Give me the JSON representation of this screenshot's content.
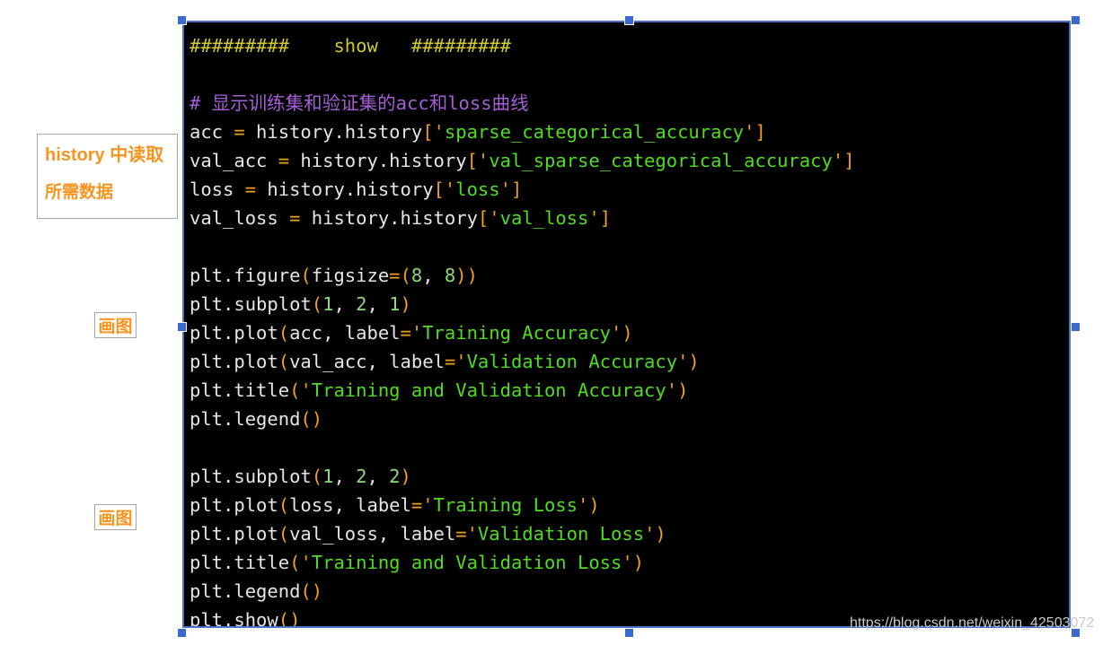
{
  "annotations": {
    "history_box": {
      "line1": "history 中读取",
      "line2": "所需数据"
    },
    "draw_box_1": "画图",
    "draw_box_2": "画图"
  },
  "watermark": "https://blog.csdn.net/weixin_42503072",
  "colors": {
    "background": "#ffffff",
    "code_background": "#000000",
    "selection_border": "#4a72c4",
    "handle": "#3a69cf",
    "annotation_text": "#f7941e",
    "annotation_border": "#a6a6a6",
    "header_comment": "#cfcb2e",
    "comment": "#a45ed6",
    "identifier": "#e6e6e6",
    "punctuation": "#f0a020",
    "string": "#4fdd1e",
    "number": "#8fd97a",
    "watermark": "#c9c9c9"
  },
  "code": {
    "language": "python",
    "lines": [
      {
        "id": "l1",
        "text": "#########    show   #########",
        "tokens": [
          {
            "t": "#########    show   #########",
            "c": "head"
          }
        ]
      },
      {
        "id": "l2",
        "text": "",
        "tokens": []
      },
      {
        "id": "l3",
        "text": "# 显示训练集和验证集的acc和loss曲线",
        "tokens": [
          {
            "t": "# 显示训练集和验证集的acc和loss曲线",
            "c": "comment"
          }
        ]
      },
      {
        "id": "l4",
        "text": "acc = history.history['sparse_categorical_accuracy']",
        "tokens": [
          {
            "t": "acc ",
            "c": "name"
          },
          {
            "t": "=",
            "c": "punc"
          },
          {
            "t": " history.history",
            "c": "name"
          },
          {
            "t": "[",
            "c": "punc"
          },
          {
            "t": "'",
            "c": "punc"
          },
          {
            "t": "sparse_categorical_accuracy",
            "c": "str"
          },
          {
            "t": "'",
            "c": "punc"
          },
          {
            "t": "]",
            "c": "punc"
          }
        ]
      },
      {
        "id": "l5",
        "text": "val_acc = history.history['val_sparse_categorical_accuracy']",
        "tokens": [
          {
            "t": "val_acc ",
            "c": "name"
          },
          {
            "t": "=",
            "c": "punc"
          },
          {
            "t": " history.history",
            "c": "name"
          },
          {
            "t": "[",
            "c": "punc"
          },
          {
            "t": "'",
            "c": "punc"
          },
          {
            "t": "val_sparse_categorical_accuracy",
            "c": "str"
          },
          {
            "t": "'",
            "c": "punc"
          },
          {
            "t": "]",
            "c": "punc"
          }
        ]
      },
      {
        "id": "l6",
        "text": "loss = history.history['loss']",
        "tokens": [
          {
            "t": "loss ",
            "c": "name"
          },
          {
            "t": "=",
            "c": "punc"
          },
          {
            "t": " history.history",
            "c": "name"
          },
          {
            "t": "[",
            "c": "punc"
          },
          {
            "t": "'",
            "c": "punc"
          },
          {
            "t": "loss",
            "c": "str"
          },
          {
            "t": "'",
            "c": "punc"
          },
          {
            "t": "]",
            "c": "punc"
          }
        ]
      },
      {
        "id": "l7",
        "text": "val_loss = history.history['val_loss']",
        "tokens": [
          {
            "t": "val_loss ",
            "c": "name"
          },
          {
            "t": "=",
            "c": "punc"
          },
          {
            "t": " history.history",
            "c": "name"
          },
          {
            "t": "[",
            "c": "punc"
          },
          {
            "t": "'",
            "c": "punc"
          },
          {
            "t": "val_loss",
            "c": "str"
          },
          {
            "t": "'",
            "c": "punc"
          },
          {
            "t": "]",
            "c": "punc"
          }
        ]
      },
      {
        "id": "l8",
        "text": "",
        "tokens": []
      },
      {
        "id": "l9",
        "text": "plt.figure(figsize=(8, 8))",
        "tokens": [
          {
            "t": "plt.figure",
            "c": "name"
          },
          {
            "t": "(",
            "c": "punc"
          },
          {
            "t": "figsize",
            "c": "name"
          },
          {
            "t": "=(",
            "c": "punc"
          },
          {
            "t": "8",
            "c": "num"
          },
          {
            "t": ", ",
            "c": "name"
          },
          {
            "t": "8",
            "c": "num"
          },
          {
            "t": "))",
            "c": "punc"
          }
        ]
      },
      {
        "id": "l10",
        "text": "plt.subplot(1, 2, 1)",
        "tokens": [
          {
            "t": "plt.subplot",
            "c": "name"
          },
          {
            "t": "(",
            "c": "punc"
          },
          {
            "t": "1",
            "c": "num"
          },
          {
            "t": ", ",
            "c": "name"
          },
          {
            "t": "2",
            "c": "num"
          },
          {
            "t": ", ",
            "c": "name"
          },
          {
            "t": "1",
            "c": "num"
          },
          {
            "t": ")",
            "c": "punc"
          }
        ]
      },
      {
        "id": "l11",
        "text": "plt.plot(acc, label='Training Accuracy')",
        "tokens": [
          {
            "t": "plt.plot",
            "c": "name"
          },
          {
            "t": "(",
            "c": "punc"
          },
          {
            "t": "acc, label",
            "c": "name"
          },
          {
            "t": "=",
            "c": "punc"
          },
          {
            "t": "'",
            "c": "punc"
          },
          {
            "t": "Training Accuracy",
            "c": "str"
          },
          {
            "t": "'",
            "c": "punc"
          },
          {
            "t": ")",
            "c": "punc"
          }
        ]
      },
      {
        "id": "l12",
        "text": "plt.plot(val_acc, label='Validation Accuracy')",
        "tokens": [
          {
            "t": "plt.plot",
            "c": "name"
          },
          {
            "t": "(",
            "c": "punc"
          },
          {
            "t": "val_acc, label",
            "c": "name"
          },
          {
            "t": "=",
            "c": "punc"
          },
          {
            "t": "'",
            "c": "punc"
          },
          {
            "t": "Validation Accuracy",
            "c": "str"
          },
          {
            "t": "'",
            "c": "punc"
          },
          {
            "t": ")",
            "c": "punc"
          }
        ]
      },
      {
        "id": "l13",
        "text": "plt.title('Training and Validation Accuracy')",
        "tokens": [
          {
            "t": "plt.title",
            "c": "name"
          },
          {
            "t": "(",
            "c": "punc"
          },
          {
            "t": "'",
            "c": "punc"
          },
          {
            "t": "Training and Validation Accuracy",
            "c": "str"
          },
          {
            "t": "'",
            "c": "punc"
          },
          {
            "t": ")",
            "c": "punc"
          }
        ]
      },
      {
        "id": "l14",
        "text": "plt.legend()",
        "tokens": [
          {
            "t": "plt.legend",
            "c": "name"
          },
          {
            "t": "()",
            "c": "punc"
          }
        ]
      },
      {
        "id": "l15",
        "text": "",
        "tokens": []
      },
      {
        "id": "l16",
        "text": "plt.subplot(1, 2, 2)",
        "tokens": [
          {
            "t": "plt.subplot",
            "c": "name"
          },
          {
            "t": "(",
            "c": "punc"
          },
          {
            "t": "1",
            "c": "num"
          },
          {
            "t": ", ",
            "c": "name"
          },
          {
            "t": "2",
            "c": "num"
          },
          {
            "t": ", ",
            "c": "name"
          },
          {
            "t": "2",
            "c": "num"
          },
          {
            "t": ")",
            "c": "punc"
          }
        ]
      },
      {
        "id": "l17",
        "text": "plt.plot(loss, label='Training Loss')",
        "tokens": [
          {
            "t": "plt.plot",
            "c": "name"
          },
          {
            "t": "(",
            "c": "punc"
          },
          {
            "t": "loss, label",
            "c": "name"
          },
          {
            "t": "=",
            "c": "punc"
          },
          {
            "t": "'",
            "c": "punc"
          },
          {
            "t": "Training Loss",
            "c": "str"
          },
          {
            "t": "'",
            "c": "punc"
          },
          {
            "t": ")",
            "c": "punc"
          }
        ]
      },
      {
        "id": "l18",
        "text": "plt.plot(val_loss, label='Validation Loss')",
        "tokens": [
          {
            "t": "plt.plot",
            "c": "name"
          },
          {
            "t": "(",
            "c": "punc"
          },
          {
            "t": "val_loss, label",
            "c": "name"
          },
          {
            "t": "=",
            "c": "punc"
          },
          {
            "t": "'",
            "c": "punc"
          },
          {
            "t": "Validation Loss",
            "c": "str"
          },
          {
            "t": "'",
            "c": "punc"
          },
          {
            "t": ")",
            "c": "punc"
          }
        ]
      },
      {
        "id": "l19",
        "text": "plt.title('Training and Validation Loss')",
        "tokens": [
          {
            "t": "plt.title",
            "c": "name"
          },
          {
            "t": "(",
            "c": "punc"
          },
          {
            "t": "'",
            "c": "punc"
          },
          {
            "t": "Training and Validation Loss",
            "c": "str"
          },
          {
            "t": "'",
            "c": "punc"
          },
          {
            "t": ")",
            "c": "punc"
          }
        ]
      },
      {
        "id": "l20",
        "text": "plt.legend()",
        "tokens": [
          {
            "t": "plt.legend",
            "c": "name"
          },
          {
            "t": "()",
            "c": "punc"
          }
        ]
      },
      {
        "id": "l21",
        "text": "plt.show()",
        "tokens": [
          {
            "t": "plt.show",
            "c": "name"
          },
          {
            "t": "()",
            "c": "punc"
          }
        ]
      }
    ]
  },
  "selection_handles": [
    "top-left",
    "top-center",
    "top-right",
    "middle-left",
    "middle-right",
    "bottom-left",
    "bottom-center",
    "bottom-right"
  ]
}
